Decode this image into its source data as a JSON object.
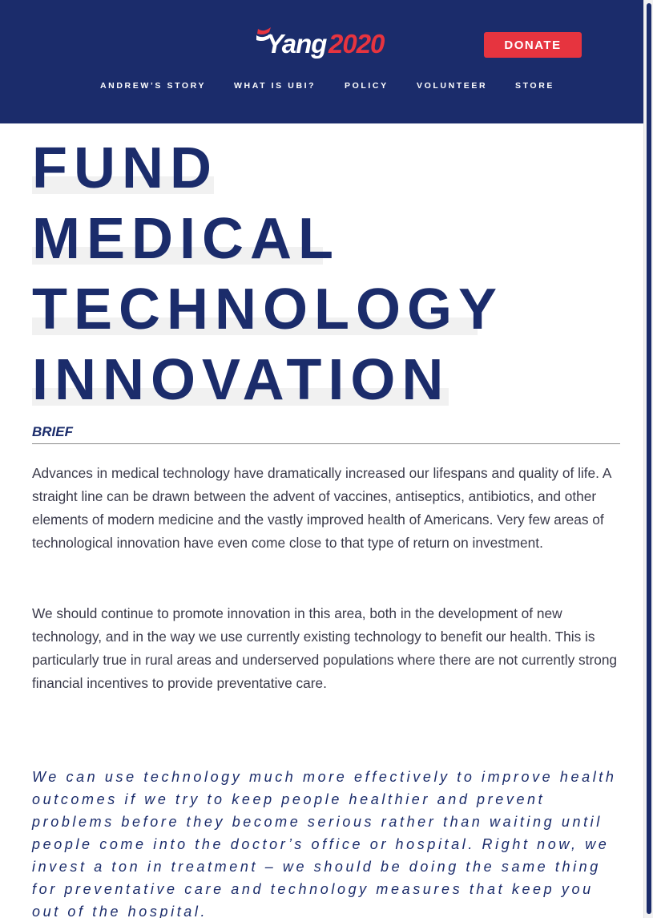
{
  "header": {
    "logo": {
      "name_text": "Yang",
      "year_text": "2020",
      "icon": "flag-swoosh-icon"
    },
    "donate_label": "DONATE",
    "nav": [
      "ANDREW’S STORY",
      "WHAT IS UBI?",
      "POLICY",
      "VOLUNTEER",
      "STORE"
    ]
  },
  "colors": {
    "navy": "#1b2c6b",
    "red": "#e6343f",
    "body_text": "#3a3a4a",
    "highlight": "#f1f1f1"
  },
  "title_lines": [
    "FUND",
    "MEDICAL",
    "TECHNOLOGY",
    "INNOVATION"
  ],
  "brief": {
    "label": "BRIEF",
    "paragraphs": [
      "Advances in medical technology have dramatically increased our lifespans and quality of life. A straight line can be drawn between the advent of vaccines, antiseptics, antibiotics, and other elements of modern medicine and the vastly improved health of Americans. Very few areas of technological innovation have even come close to that type of return on investment.",
      "We should continue to promote innovation in this area, both in the development of new technology, and in the way we use currently existing technology to benefit our health.  This is particularly true in rural areas and underserved populations where there are not currently strong financial incentives to provide preventative care."
    ]
  },
  "quote": "We can use technology much more effectively to improve health outcomes if we try to keep people healthier and prevent problems before they become serious rather than waiting until people come into the doctor’s office or hospital. Right now, we invest a ton in treatment – we should be doing the same thing for preventative care and technology measures that keep you out of the hospital."
}
